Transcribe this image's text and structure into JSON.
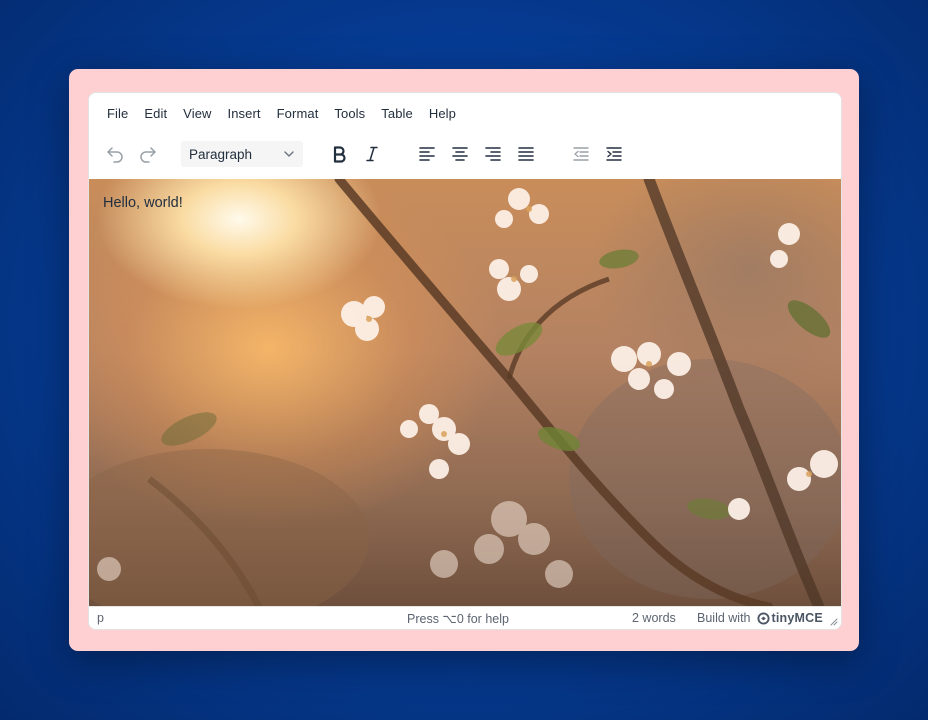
{
  "menubar": {
    "items": [
      "File",
      "Edit",
      "View",
      "Insert",
      "Format",
      "Tools",
      "Table",
      "Help"
    ]
  },
  "toolbar": {
    "block_format": "Paragraph",
    "icons": [
      "undo-icon",
      "redo-icon",
      "bold-icon",
      "italic-icon",
      "align-left-icon",
      "align-center-icon",
      "align-right-icon",
      "align-justify-icon",
      "outdent-icon",
      "indent-icon"
    ]
  },
  "content": {
    "text": "Hello, world!"
  },
  "statusbar": {
    "path": "p",
    "help": "Press ⌥0 for help",
    "word_count": "2 words",
    "branding_prefix": "Build with",
    "branding_name": "tinyMCE"
  },
  "colors": {
    "page_background": "#063d97",
    "frame": "#ffd0d2",
    "editor_text": "#222f3e"
  }
}
